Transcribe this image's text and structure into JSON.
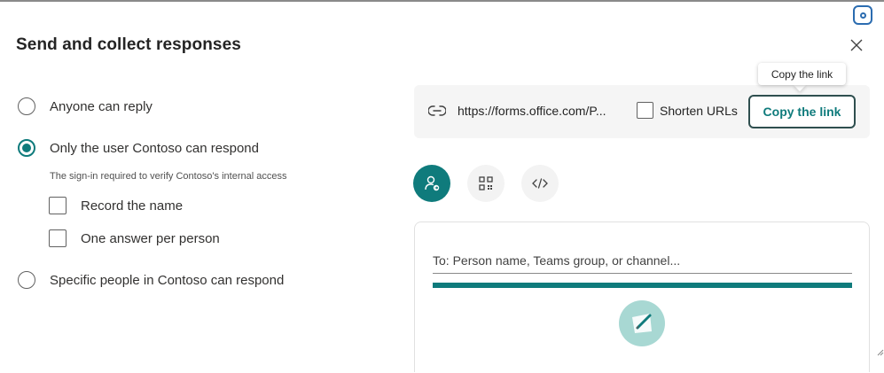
{
  "dialog": {
    "title": "Send and collect responses",
    "close_icon": "close-icon"
  },
  "options": {
    "anyone": "Anyone can reply",
    "only_user": "Only the user Contoso can respond",
    "hint": "The sign-in required to verify Contoso's internal access",
    "record_name": "Record the name",
    "one_answer": "One answer per person",
    "specific": "Specific people in Contoso can respond",
    "selected": "only_user"
  },
  "link_panel": {
    "url": "https://forms.office.com/P...",
    "shorten_label": "Shorten URLs",
    "shorten_checked": false,
    "copy_button": "Copy the link",
    "tooltip": "Copy the link"
  },
  "methods": [
    {
      "icon": "person-send-icon",
      "active": true
    },
    {
      "icon": "qr-code-icon",
      "active": false
    },
    {
      "icon": "embed-code-icon",
      "active": false
    }
  ],
  "recipient": {
    "placeholder": "To: Person name, Teams group, or channel...",
    "progress": 1.0
  },
  "colors": {
    "accent": "#0f7b7c",
    "panel_bg": "#f5f5f5"
  }
}
